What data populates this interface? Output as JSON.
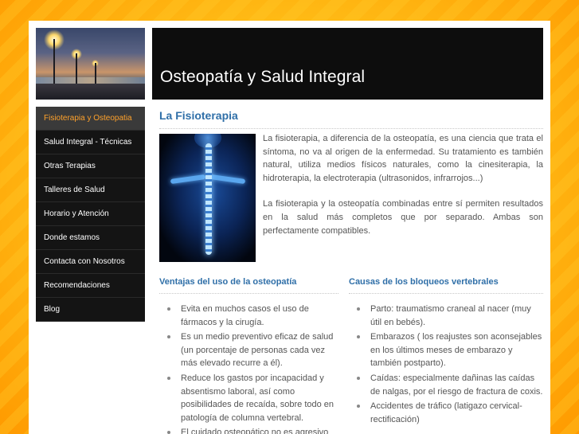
{
  "site": {
    "title": "Osteopatía y Salud Integral"
  },
  "nav": {
    "items": [
      {
        "label": "Fisioterapia y Osteopatia",
        "active": true
      },
      {
        "label": "Salud Integral - Técnicas"
      },
      {
        "label": "Otras Terapias"
      },
      {
        "label": "Talleres de Salud"
      },
      {
        "label": "Horario y Atención"
      },
      {
        "label": "Donde estamos"
      },
      {
        "label": "Contacta con Nosotros"
      },
      {
        "label": "Recomendaciones"
      },
      {
        "label": "Blog"
      }
    ]
  },
  "main": {
    "title": "La Fisioterapia",
    "paragraphs": [
      "La fisioterapia, a diferencia de la osteopatía, es una ciencia que trata el síntoma, no va al origen de la enfermedad. Su tratamiento es también natural, utiliza medios físicos naturales, como la cinesiterapia, la hidroterapia,  la electroterapia (ultrasonidos, infrarrojos...)",
      "La fisioterapia y la osteopatía combinadas entre sí permiten resultados en la salud más completos que por separado. Ambas son perfectamente compatibles."
    ],
    "left_column": {
      "title": "Ventajas del uso de la osteopatía",
      "items": [
        "Evita en muchos casos el uso de fármacos y la cirugía.",
        "Es un medio preventivo eficaz de salud (un porcentaje de personas cada vez más elevado recurre a él).",
        "Reduce los gastos por incapacidad y absentismo laboral, así como posibilidades de recaída, sobre todo en patología de columna vertebral.",
        "El cuidado osteopático no es agresivo"
      ]
    },
    "right_column": {
      "title": "Causas de los bloqueos vertebrales",
      "items": [
        "Parto: traumatismo craneal al nacer (muy útil en bebés).",
        "Embarazos ( los reajustes son aconsejables en los últimos meses de embarazo y también postparto).",
        "Caídas: especialmente dañinas las caídas de nalgas, por el riesgo de fractura de coxis.",
        "Accidentes de tráfico (latigazo cervical-rectificación)"
      ]
    }
  },
  "colors": {
    "accent_blue": "#2f6fa8",
    "nav_active": "#ffa22b",
    "background_orange": "#ffb300"
  }
}
